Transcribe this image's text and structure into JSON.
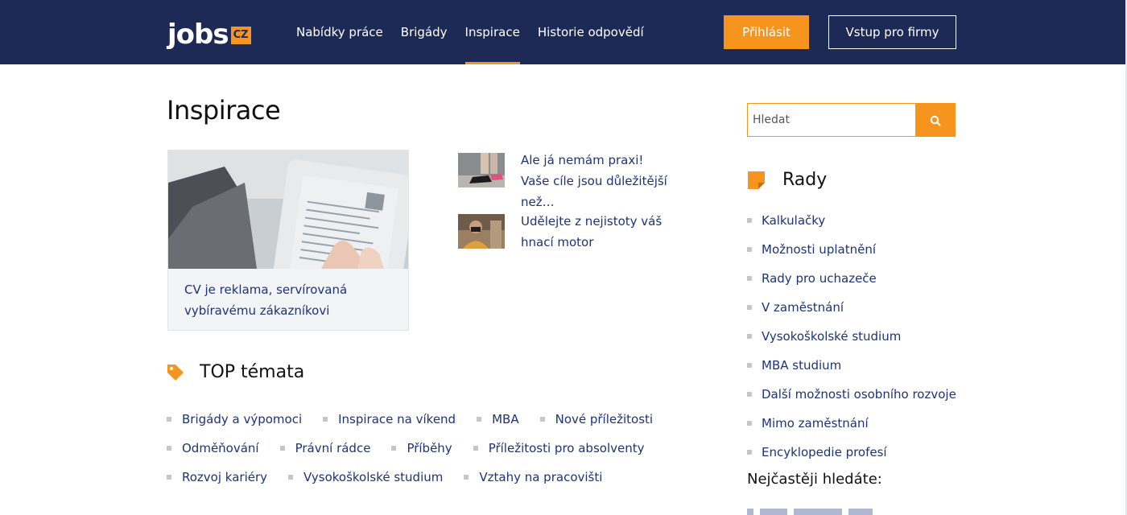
{
  "header": {
    "logo_word": "jobs",
    "logo_badge": "CZ",
    "nav": [
      {
        "label": "Nabídky práce"
      },
      {
        "label": "Brigády"
      },
      {
        "label": "Inspirace",
        "active": true
      },
      {
        "label": "Historie odpovědí"
      }
    ],
    "login_label": "Přihlásit",
    "firms_label": "Vstup pro firmy"
  },
  "main": {
    "title": "Inspirace",
    "feature": {
      "caption": "CV je reklama, servírovaná vybíravému zákazníkovi"
    },
    "side_articles": [
      {
        "title": "Ale já nemám praxi! Vaše cíle jsou důležitější než…"
      },
      {
        "title": "Udělejte z nejistoty váš hnací motor"
      }
    ],
    "top_topics": {
      "title": "TOP témata",
      "rows": [
        [
          "Brigády a výpomoci",
          "Inspirace na víkend",
          "MBA",
          "Nové příležitosti"
        ],
        [
          "Odměňování",
          "Právní rádce",
          "Příběhy",
          "Příležitosti pro absolventy"
        ],
        [
          "Rozvoj kariéry",
          "Vysokoškolské studium",
          "Vztahy na pracovišti"
        ]
      ]
    }
  },
  "sidebar": {
    "search": {
      "placeholder": "Hledat"
    },
    "rady": {
      "title": "Rady",
      "items": [
        "Kalkulačky",
        "Možnosti uplatnění",
        "Rady pro uchazeče",
        "V zaměstnání",
        "Vysokoškolské studium",
        "MBA studium",
        "Další možnosti osobního rozvoje",
        "Mimo zaměstnání",
        "Encyklopedie profesí"
      ]
    },
    "often_title": "Nejčastěji hledáte:"
  },
  "colors": {
    "navy": "#1d2a55",
    "accent": "#f7941d",
    "link": "#1e3278"
  }
}
